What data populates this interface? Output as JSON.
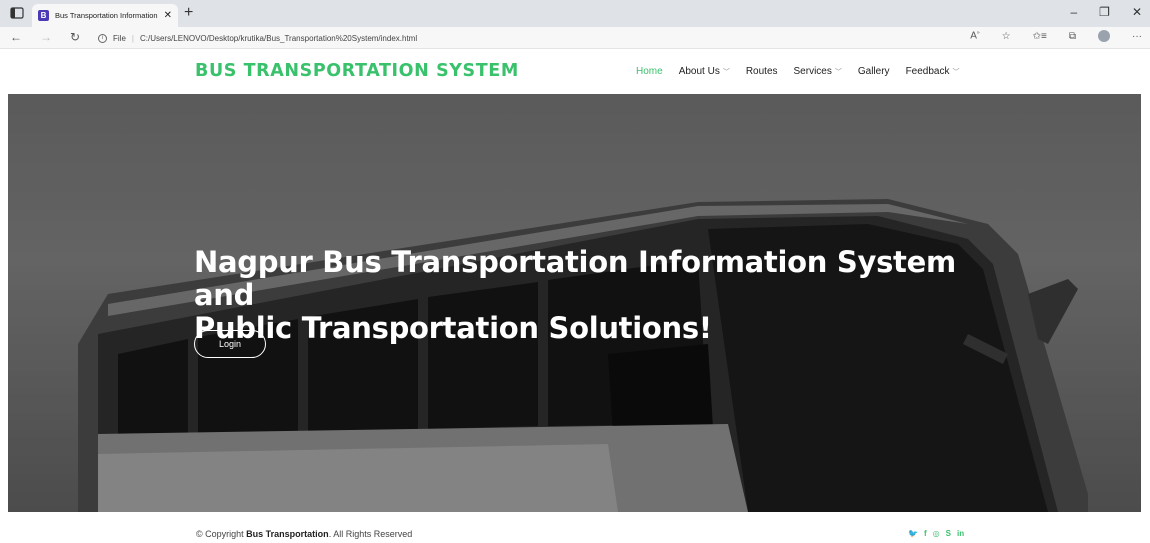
{
  "browser": {
    "tab_title": "Bus Transportation Information S",
    "tab_favicon": "B",
    "url_label": "File",
    "url": "C:/Users/LENOVO/Desktop/krutika/Bus_Transportation%20System/index.html",
    "controls": {
      "minimize": "–",
      "restore": "❐",
      "close": "✕"
    }
  },
  "header": {
    "logo": "BUS TRANSPORTATION SYSTEM",
    "nav": [
      {
        "label": "Home",
        "active": true,
        "dropdown": false
      },
      {
        "label": "About Us",
        "active": false,
        "dropdown": true
      },
      {
        "label": "Routes",
        "active": false,
        "dropdown": false
      },
      {
        "label": "Services",
        "active": false,
        "dropdown": true
      },
      {
        "label": "Gallery",
        "active": false,
        "dropdown": false
      },
      {
        "label": "Feedback",
        "active": false,
        "dropdown": true
      }
    ]
  },
  "hero": {
    "title_line1": "Nagpur Bus Transportation Information System and",
    "title_line2": "Public Transportation Solutions!",
    "button": "Login"
  },
  "footer": {
    "copyright_prefix": "© Copyright",
    "copyright_brand": "Bus Transportation",
    "copyright_suffix": ". All Rights Reserved",
    "socials": [
      "twitter-icon",
      "facebook-icon",
      "instagram-icon",
      "skype-icon",
      "linkedin-icon"
    ]
  },
  "colors": {
    "accent": "#39c16c"
  }
}
